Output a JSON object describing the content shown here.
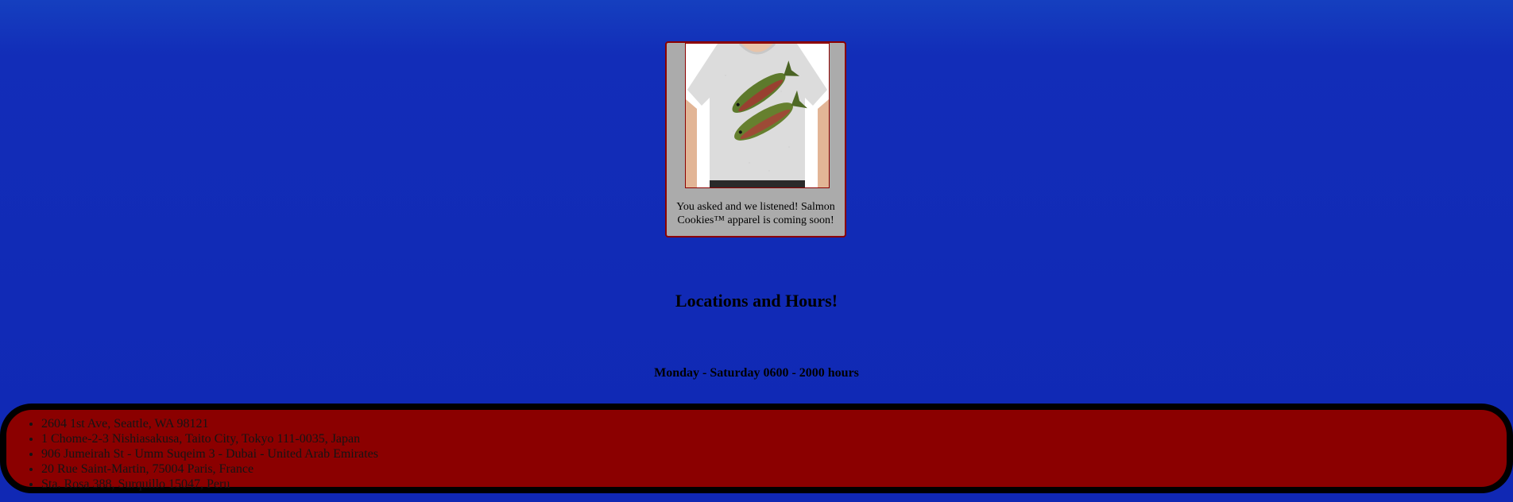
{
  "promo": {
    "image_alt": "Salmon T-shirt",
    "text": "You asked and we listened! Salmon Cookies™ apparel is coming soon!"
  },
  "locations_heading": "Locations and Hours!",
  "hours_heading": "Monday - Saturday 0600 - 2000 hours",
  "locations": [
    "2604 1st Ave, Seattle, WA 98121",
    "1 Chome-2-3 Nishiasakusa, Taito City, Tokyo 111-0035, Japan",
    "906 Jumeirah St - Umm Suqeim 3 - Dubai - United Arab Emirates",
    "20 Rue Saint-Martin, 75004 Paris, France",
    "Sta. Rosa 388, Surquillo 15047, Peru"
  ],
  "colors": {
    "background": "#122db8",
    "card": "#ababab",
    "accent": "#8b0000",
    "panel_border": "#000000"
  }
}
